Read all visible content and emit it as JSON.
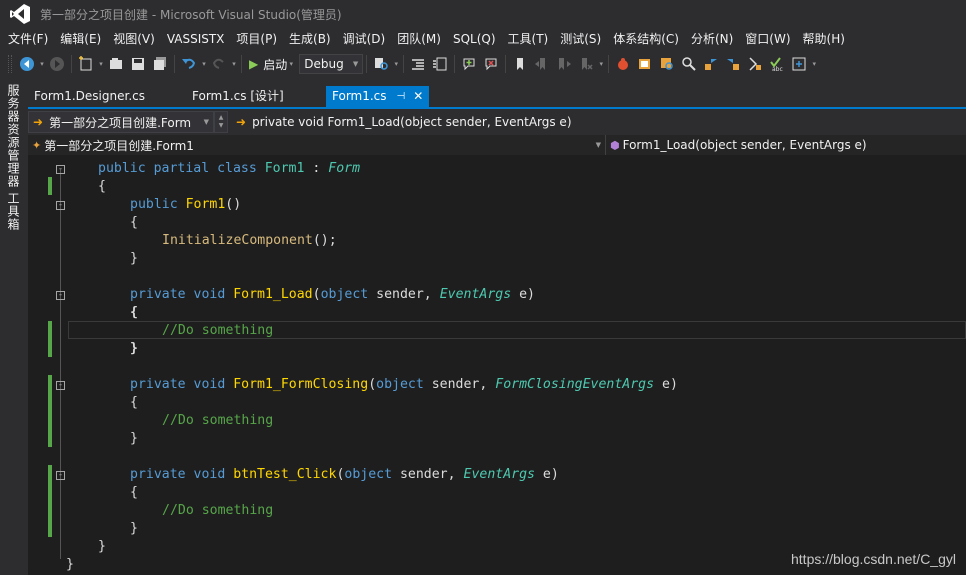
{
  "window": {
    "title": "第一部分之项目创建 - Microsoft Visual Studio(管理员)"
  },
  "menu": [
    "文件(F)",
    "编辑(E)",
    "视图(V)",
    "VASSISTX",
    "项目(P)",
    "生成(B)",
    "调试(D)",
    "团队(M)",
    "SQL(Q)",
    "工具(T)",
    "测试(S)",
    "体系结构(C)",
    "分析(N)",
    "窗口(W)",
    "帮助(H)"
  ],
  "toolbar": {
    "start_label": "启动",
    "config": "Debug"
  },
  "left_panel": {
    "server_explorer": "服务器资源管理器",
    "toolbox": "工具箱"
  },
  "tabs": [
    {
      "label": "Form1.Designer.cs"
    },
    {
      "label": "Form1.cs [设计]"
    },
    {
      "label": "Form1.cs"
    }
  ],
  "nav": {
    "type_combo": "第一部分之项目创建.Form",
    "member_combo": "private void Form1_Load(object sender, EventArgs e)",
    "class_combo": "第一部分之项目创建.Form1",
    "method_combo": "Form1_Load(object sender, EventArgs e)"
  },
  "colors": {
    "accent": "#007acc",
    "editor_bg": "#1e1e1e",
    "keyword": "#569cd6",
    "type": "#4ec9b0",
    "comment": "#57a64a",
    "method": "#ffd700"
  },
  "code": {
    "l1_kw": "public partial class ",
    "l1_cls": "Form1",
    "l1_colon": " : ",
    "l1_base": "Form",
    "brace_open": "{",
    "brace_close": "}",
    "ctor_kw": "public ",
    "ctor_name": "Form1",
    "ctor_parens": "()",
    "init_call": "InitializeComponent",
    "init_tail": "();",
    "load_kw": "private void ",
    "load_name": "Form1_Load",
    "load_p1": "(",
    "load_obj": "object",
    "load_p2": " sender, ",
    "load_type": "EventArgs",
    "load_p3": " e)",
    "comment": "//Do something",
    "closing_kw": "private void ",
    "closing_name": "Form1_FormClosing",
    "closing_p1": "(",
    "closing_obj": "object",
    "closing_p2": " sender, ",
    "closing_type": "FormClosingEventArgs",
    "closing_p3": " e)",
    "click_kw": "private void ",
    "click_name": "btnTest_Click",
    "click_p1": "(",
    "click_obj": "object",
    "click_p2": " sender, ",
    "click_type": "EventArgs",
    "click_p3": " e)"
  },
  "watermark": "https://blog.csdn.net/C_gyl"
}
